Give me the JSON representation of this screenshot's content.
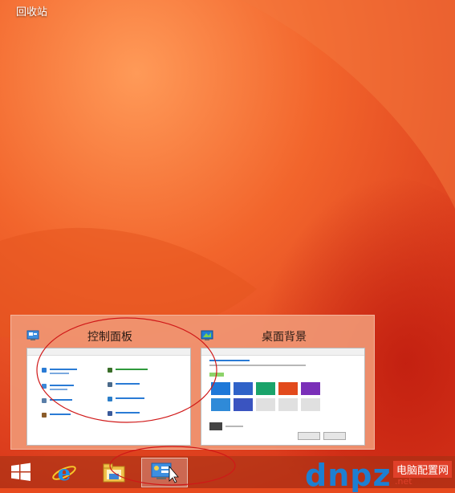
{
  "desktop": {
    "recycle_bin_label": "回收站"
  },
  "preview": {
    "thumbnails": [
      {
        "title": "控制面板",
        "icon": "control-panel-icon"
      },
      {
        "title": "桌面背景",
        "icon": "personalization-icon"
      }
    ]
  },
  "taskbar": {
    "items": [
      {
        "icon": "windows-start-icon"
      },
      {
        "icon": "internet-explorer-icon"
      },
      {
        "icon": "file-explorer-icon"
      },
      {
        "icon": "control-panel-icon"
      }
    ]
  },
  "watermark": {
    "main": "dnpz",
    "sub": "电脑配置网",
    "url": ".net"
  },
  "colors": {
    "accent_orange": "#e84a1e",
    "annotation_red": "#d01818"
  }
}
